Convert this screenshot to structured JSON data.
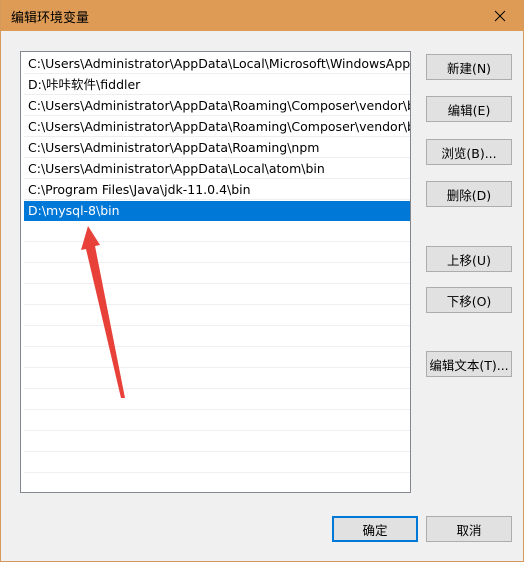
{
  "window": {
    "title": "编辑环境变量",
    "accent": "#dd9b56"
  },
  "list": {
    "items": [
      "C:\\Users\\Administrator\\AppData\\Local\\Microsoft\\WindowsApps",
      "D:\\咔咔软件\\fiddler",
      "C:\\Users\\Administrator\\AppData\\Roaming\\Composer\\vendor\\b...",
      "C:\\Users\\Administrator\\AppData\\Roaming\\Composer\\vendor\\b...",
      "C:\\Users\\Administrator\\AppData\\Roaming\\npm",
      "C:\\Users\\Administrator\\AppData\\Local\\atom\\bin",
      "C:\\Program Files\\Java\\jdk-11.0.4\\bin",
      "D:\\mysql-8\\bin"
    ],
    "selected_index": 7,
    "selection_color": "#0078d7"
  },
  "buttons": {
    "new": "新建(N)",
    "edit": "编辑(E)",
    "browse": "浏览(B)...",
    "delete": "删除(D)",
    "move_up": "上移(U)",
    "move_down": "下移(O)",
    "edit_text": "编辑文本(T)...",
    "ok": "确定",
    "cancel": "取消"
  },
  "annotation": {
    "arrow_color": "#e8413a",
    "icon": "red-arrow-icon"
  }
}
